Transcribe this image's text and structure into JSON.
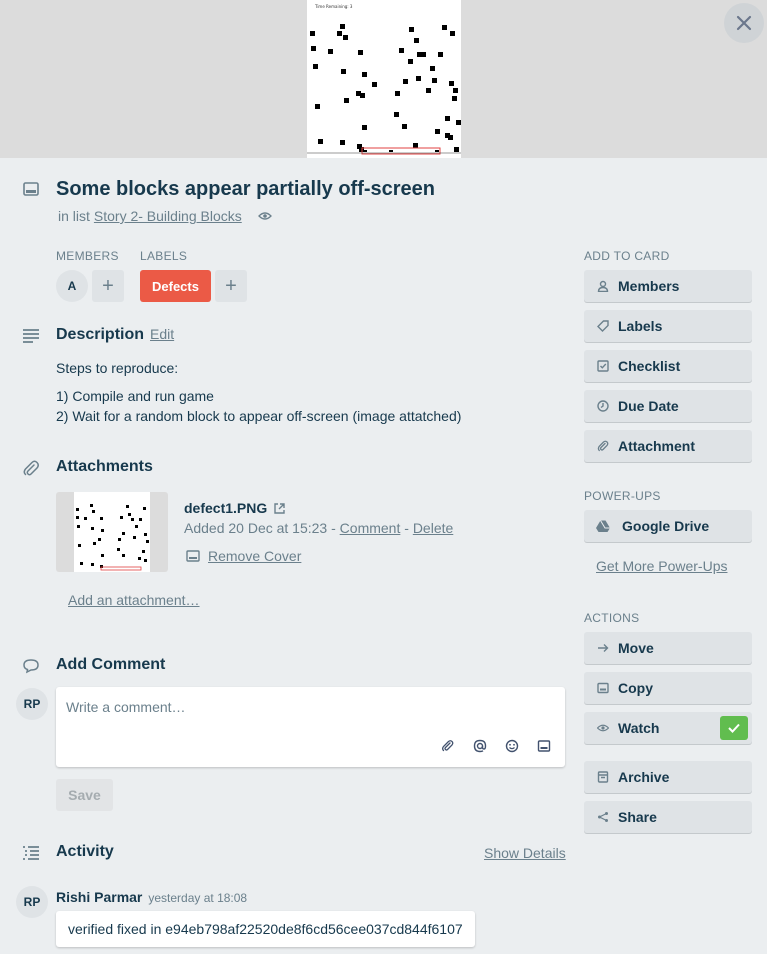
{
  "card": {
    "title": "Some blocks appear partially off-screen",
    "in_list_prefix": "in list",
    "list_name": "Story 2- Building Blocks",
    "cover_caption": "Time Remaining: 3"
  },
  "members": {
    "heading": "MEMBERS",
    "avatar_initial": "A",
    "add_symbol": "+"
  },
  "labels": {
    "heading": "LABELS",
    "items": [
      {
        "name": "Defects",
        "color": "#eb5a46"
      }
    ],
    "add_symbol": "+"
  },
  "description": {
    "heading": "Description",
    "edit_label": "Edit",
    "lines": [
      "Steps to reproduce:",
      "1) Compile and run game",
      "2) Wait for a random block to appear off-screen (image attatched)"
    ]
  },
  "attachments": {
    "heading": "Attachments",
    "file_name": "defect1.PNG",
    "added_text": "Added 20 Dec at 15:23 - ",
    "comment_label": "Comment",
    "separator": " - ",
    "delete_label": "Delete",
    "remove_cover_label": "Remove Cover",
    "add_label": "Add an attachment…"
  },
  "add_comment": {
    "heading": "Add Comment",
    "avatar_initials": "RP",
    "placeholder": "Write a comment…",
    "save_label": "Save"
  },
  "activity": {
    "heading": "Activity",
    "show_details_label": "Show Details",
    "entry": {
      "avatar_initials": "RP",
      "author": "Rishi Parmar",
      "time": "yesterday at 18:08",
      "comment": "verified fixed in e94eb798af22520de8f6cd56cee037cd844f6107"
    }
  },
  "sidebar": {
    "add_to_card_heading": "ADD TO CARD",
    "add_to_card": [
      {
        "label": "Members",
        "icon": "person-icon"
      },
      {
        "label": "Labels",
        "icon": "tag-icon"
      },
      {
        "label": "Checklist",
        "icon": "checkbox-icon"
      },
      {
        "label": "Due Date",
        "icon": "clock-icon"
      },
      {
        "label": "Attachment",
        "icon": "paperclip-icon"
      }
    ],
    "powerups_heading": "POWER-UPS",
    "google_drive_label": "Google Drive",
    "get_more_label": "Get More Power-Ups",
    "actions_heading": "ACTIONS",
    "actions": [
      {
        "label": "Move",
        "icon": "arrow-right-icon"
      },
      {
        "label": "Copy",
        "icon": "card-icon"
      },
      {
        "label": "Watch",
        "icon": "eye-icon"
      },
      {
        "label": "Archive",
        "icon": "archive-icon"
      },
      {
        "label": "Share",
        "icon": "share-icon"
      }
    ],
    "watch_active": true,
    "watch_color": "#61bd4f"
  }
}
